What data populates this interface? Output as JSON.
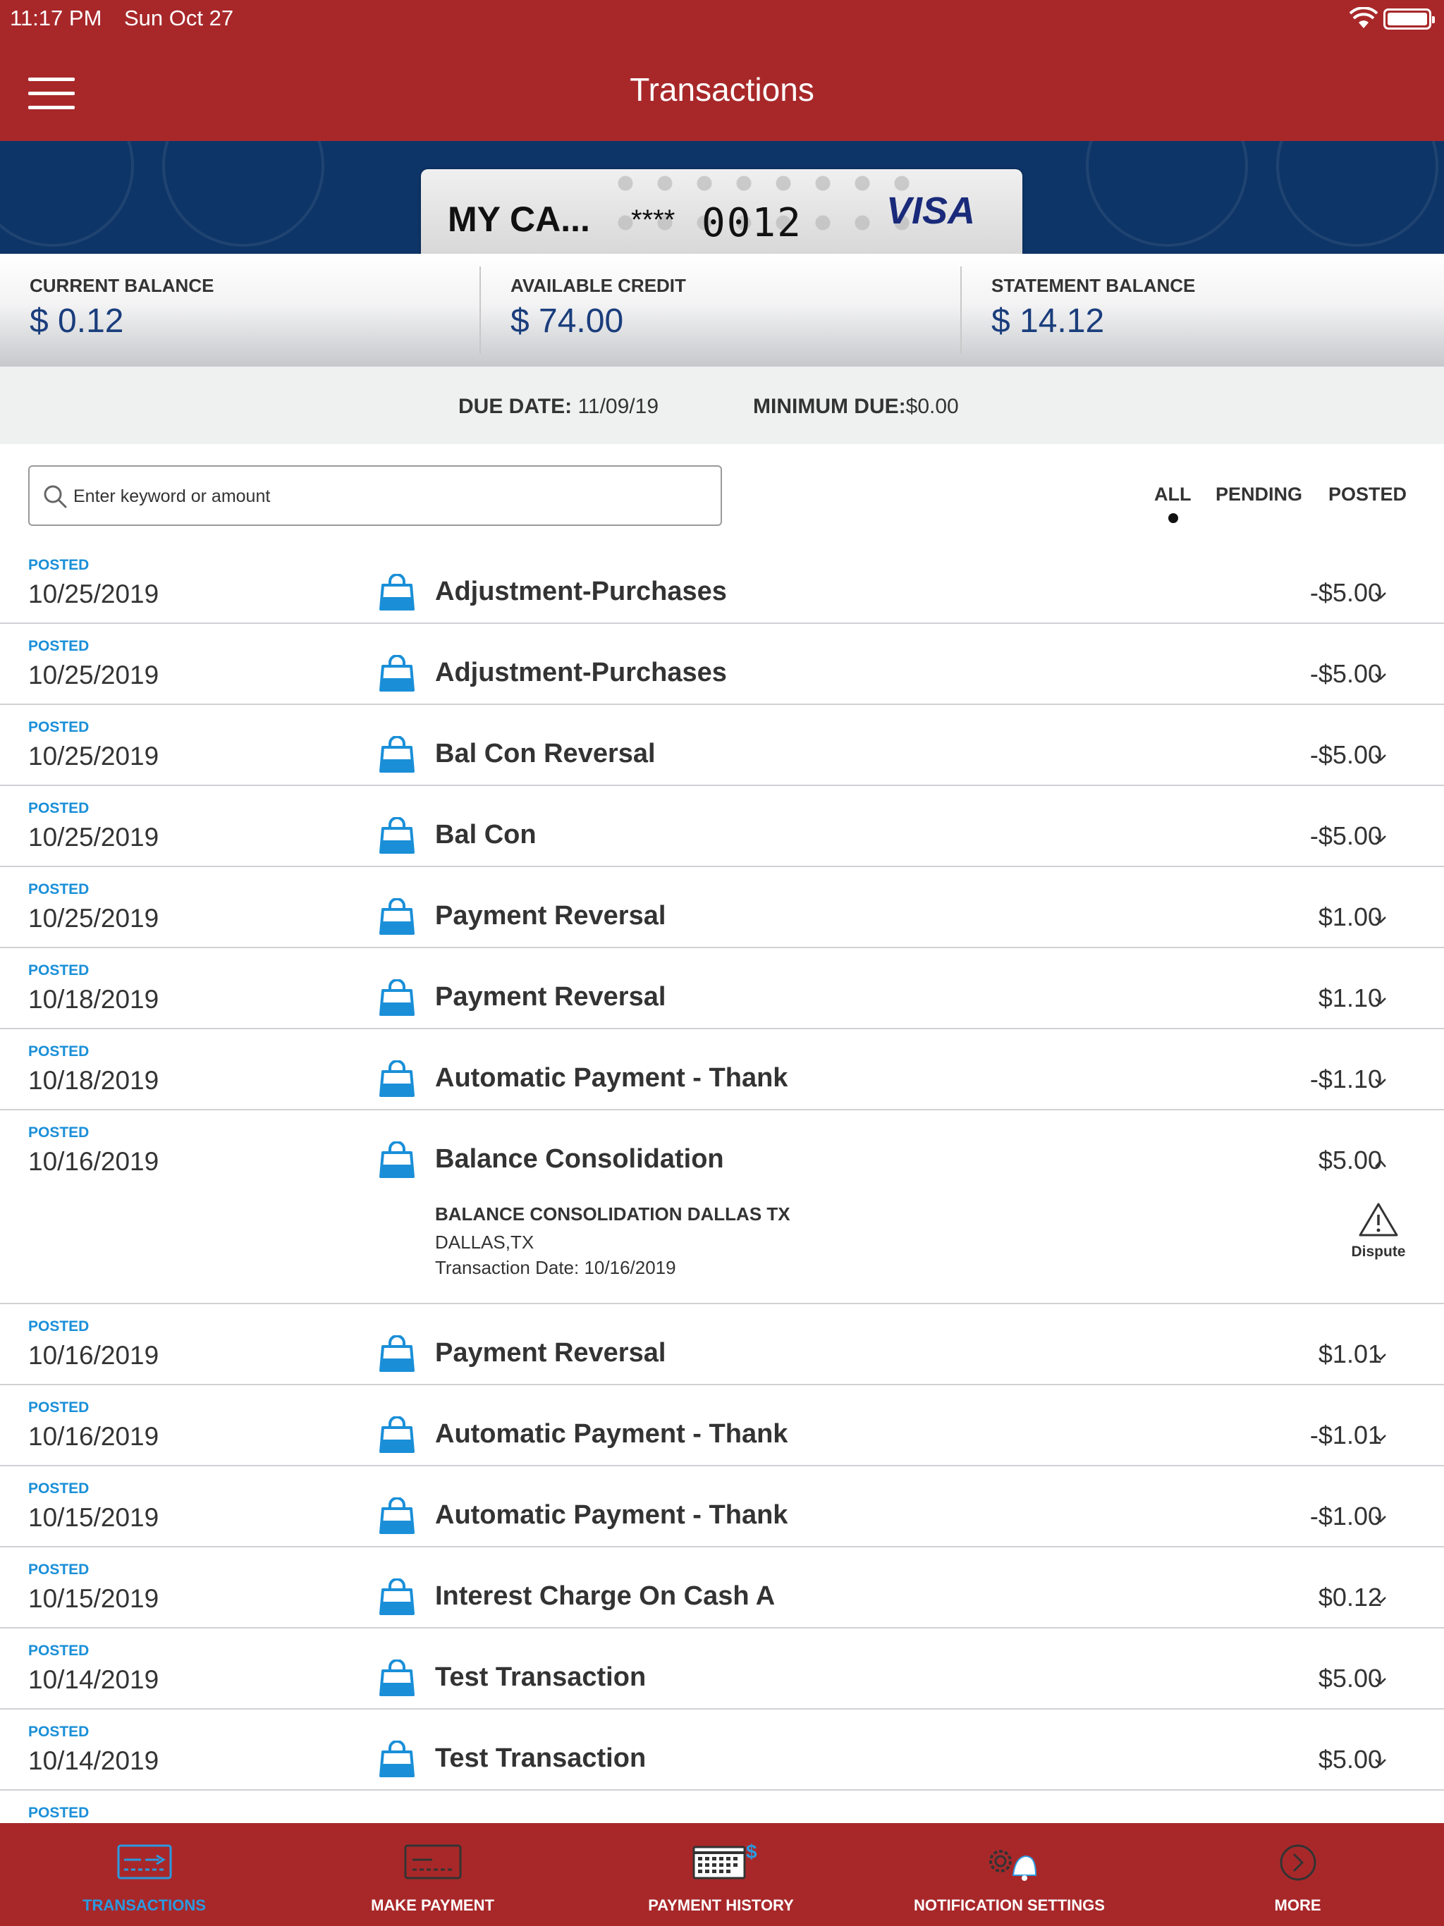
{
  "status_bar": {
    "time": "11:17 PM",
    "day": "Sun Oct 27"
  },
  "header": {
    "title": "Transactions",
    "menu_icon": "hamburger-menu-icon"
  },
  "card": {
    "name": "MY CA...",
    "mask": "****",
    "last4": "0012",
    "network": "VISA"
  },
  "balances": [
    {
      "label": "CURRENT BALANCE",
      "value": "$ 0.12"
    },
    {
      "label": "AVAILABLE CREDIT",
      "value": "$ 74.00"
    },
    {
      "label": "STATEMENT BALANCE",
      "value": "$ 14.12"
    }
  ],
  "due": {
    "due_label": "DUE DATE:",
    "due_value": "11/09/19",
    "min_label": "MINIMUM DUE:",
    "min_value": "$0.00"
  },
  "search": {
    "placeholder": "Enter keyword or amount"
  },
  "filters": {
    "all": "ALL",
    "pending": "PENDING",
    "posted": "POSTED",
    "selected": "ALL"
  },
  "transactions": [
    {
      "status": "POSTED",
      "date": "10/25/2019",
      "desc": "Adjustment-Purchases",
      "amount": "-$5.00"
    },
    {
      "status": "POSTED",
      "date": "10/25/2019",
      "desc": "Adjustment-Purchases",
      "amount": "-$5.00"
    },
    {
      "status": "POSTED",
      "date": "10/25/2019",
      "desc": "Bal Con Reversal",
      "amount": "-$5.00"
    },
    {
      "status": "POSTED",
      "date": "10/25/2019",
      "desc": "Bal Con",
      "amount": "-$5.00"
    },
    {
      "status": "POSTED",
      "date": "10/25/2019",
      "desc": "Payment Reversal",
      "amount": "$1.00"
    },
    {
      "status": "POSTED",
      "date": "10/18/2019",
      "desc": "Payment Reversal",
      "amount": "$1.10"
    },
    {
      "status": "POSTED",
      "date": "10/18/2019",
      "desc": "Automatic Payment - Thank",
      "amount": "-$1.10"
    },
    {
      "status": "POSTED",
      "date": "10/16/2019",
      "desc": "Balance Consolidation",
      "amount": "$5.00",
      "details": {
        "merchant": "BALANCE CONSOLIDATION DALLAS TX",
        "location": "DALLAS,TX",
        "transaction_date": "Transaction Date: 10/16/2019",
        "dispute_label": "Dispute"
      }
    },
    {
      "status": "POSTED",
      "date": "10/16/2019",
      "desc": "Payment Reversal",
      "amount": "$1.01"
    },
    {
      "status": "POSTED",
      "date": "10/16/2019",
      "desc": "Automatic Payment - Thank",
      "amount": "-$1.01"
    },
    {
      "status": "POSTED",
      "date": "10/15/2019",
      "desc": "Automatic Payment - Thank",
      "amount": "-$1.00"
    },
    {
      "status": "POSTED",
      "date": "10/15/2019",
      "desc": "Interest Charge On Cash A",
      "amount": "$0.12"
    },
    {
      "status": "POSTED",
      "date": "10/14/2019",
      "desc": "Test Transaction",
      "amount": "$5.00"
    },
    {
      "status": "POSTED",
      "date": "10/14/2019",
      "desc": "Test Transaction",
      "amount": "$5.00"
    },
    {
      "status": "POSTED",
      "date": "",
      "desc": "",
      "amount": ""
    }
  ],
  "tabs": [
    {
      "label": "TRANSACTIONS",
      "icon": "transactions-card-icon",
      "active": true
    },
    {
      "label": "MAKE PAYMENT",
      "icon": "make-payment-card-icon",
      "active": false
    },
    {
      "label": "PAYMENT HISTORY",
      "icon": "payment-history-calendar-icon",
      "active": false
    },
    {
      "label": "NOTIFICATION SETTINGS",
      "icon": "notification-gear-bell-icon",
      "active": false
    },
    {
      "label": "MORE",
      "icon": "more-chevron-circle-icon",
      "active": false
    }
  ],
  "colors": {
    "brand_red": "#a8282a",
    "banner_navy": "#0e3567",
    "balance_blue": "#1a3d7c",
    "status_blue": "#1a8fd8",
    "active_tab_blue": "#2a9ae0"
  }
}
